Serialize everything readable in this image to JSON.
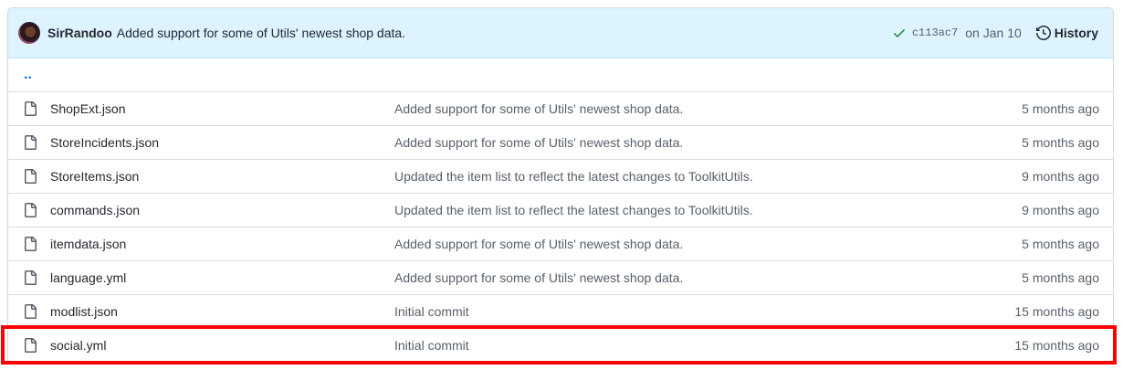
{
  "commit_bar": {
    "author": "SirRandoo",
    "message": "Added support for some of Utils' newest shop data.",
    "sha": "c113ac7",
    "date": "on Jan 10",
    "history_label": "History",
    "status_color": "#1a7f37"
  },
  "up_link": "..",
  "files": [
    {
      "name": "ShopExt.json",
      "commit": "Added support for some of Utils' newest shop data.",
      "age": "5 months ago"
    },
    {
      "name": "StoreIncidents.json",
      "commit": "Added support for some of Utils' newest shop data.",
      "age": "5 months ago"
    },
    {
      "name": "StoreItems.json",
      "commit": "Updated the item list to reflect the latest changes to ToolkitUtils.",
      "age": "9 months ago"
    },
    {
      "name": "commands.json",
      "commit": "Updated the item list to reflect the latest changes to ToolkitUtils.",
      "age": "9 months ago"
    },
    {
      "name": "itemdata.json",
      "commit": "Added support for some of Utils' newest shop data.",
      "age": "5 months ago"
    },
    {
      "name": "language.yml",
      "commit": "Added support for some of Utils' newest shop data.",
      "age": "5 months ago"
    },
    {
      "name": "modlist.json",
      "commit": "Initial commit",
      "age": "15 months ago"
    },
    {
      "name": "social.yml",
      "commit": "Initial commit",
      "age": "15 months ago"
    }
  ],
  "highlight_color": "#ff0000"
}
